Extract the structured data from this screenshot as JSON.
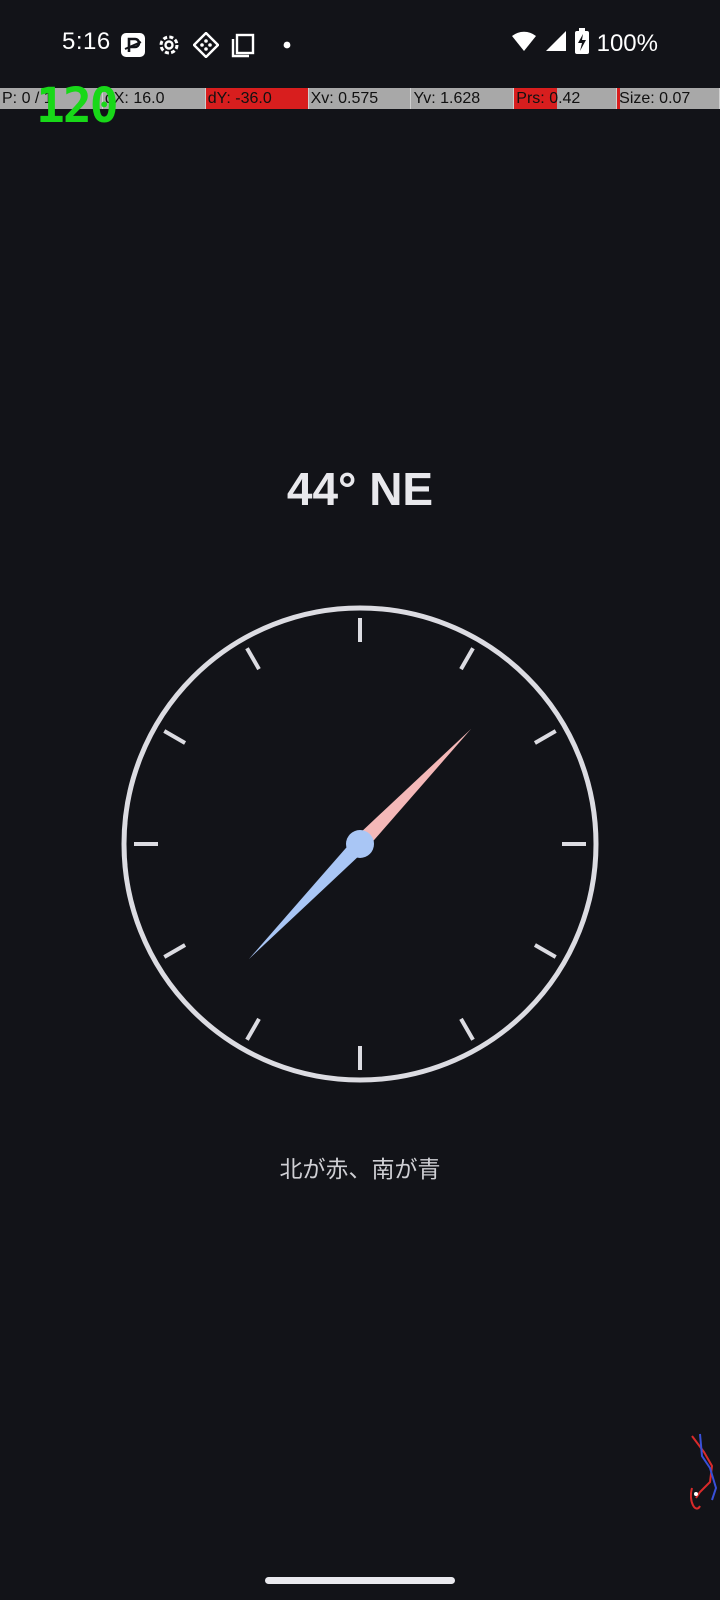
{
  "status_bar": {
    "time": "5:16",
    "battery": "100%",
    "icons": [
      "paypay-icon",
      "settings-gear-icon",
      "app-diamond-icon",
      "screenshot-copy-icon",
      "notification-dot-icon",
      "wifi-icon",
      "cellular-signal-icon",
      "battery-charging-icon"
    ]
  },
  "debug": {
    "cells": [
      "P: 0 / 1",
      "dX: 16.0",
      "dY: -36.0",
      "Xv: 0.575",
      "Yv: 1.628",
      "Prs: 0.42",
      "Size: 0.07"
    ],
    "fps": "120"
  },
  "compass": {
    "heading_text": "44° NE",
    "heading_degrees": 44,
    "north_color": "#f4b8b8",
    "south_color": "#a9c6f5",
    "ring_color": "#dcdce2",
    "caption": "北が赤、南が青"
  },
  "theme": {
    "background": "#121318",
    "fps_color": "#18d818",
    "debug_red": "#d81e1e",
    "debug_gray": "#a8a8a8"
  }
}
